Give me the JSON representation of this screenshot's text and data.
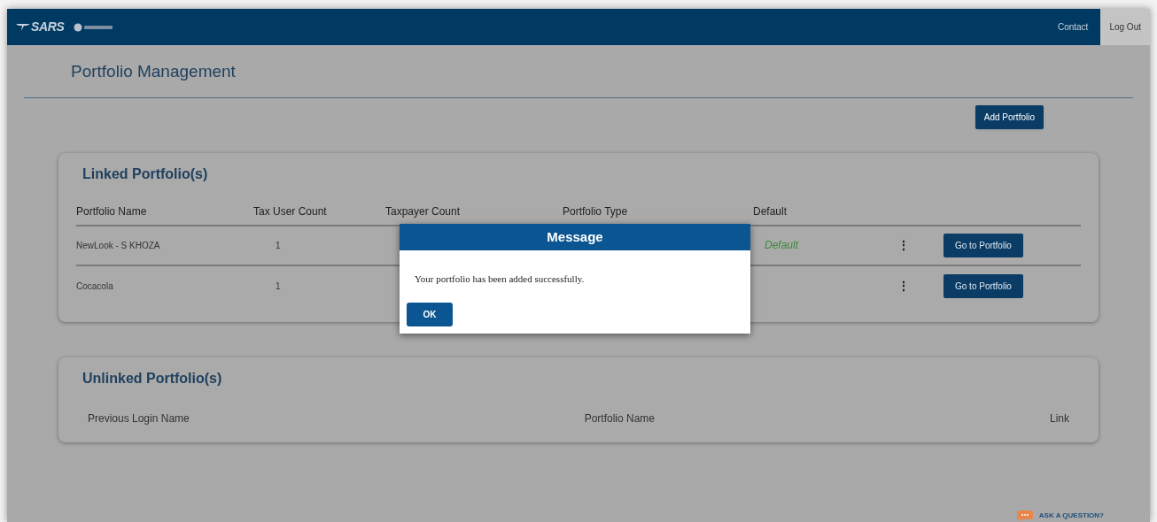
{
  "header": {
    "brand": "SARS",
    "nav": [
      {
        "label": "Contact",
        "selected": false
      },
      {
        "label": "Log Out",
        "selected": true
      }
    ]
  },
  "page_title": "Portfolio Management",
  "add_button": "Add Portfolio",
  "linked": {
    "title": "Linked Portfolio(s)",
    "columns": [
      "Portfolio Name",
      "Tax User Count",
      "Taxpayer Count",
      "Portfolio Type",
      "Default"
    ],
    "rows": [
      {
        "name": "NewLook - S KHOZA",
        "tax_user_count": "1",
        "default": "Default",
        "menu": "⋮",
        "button": "Go to Portfolio"
      },
      {
        "name": "Cocacola",
        "tax_user_count": "1",
        "menu": "⋮",
        "button": "Go to Portfolio"
      }
    ]
  },
  "unlinked": {
    "title": "Unlinked Portfolio(s)",
    "columns": [
      "Previous Login Name",
      "Portfolio Name",
      "Link"
    ]
  },
  "dialog": {
    "title": "Message",
    "text": "Your portfolio has been added successfully.",
    "button": "OK"
  },
  "help": "ASK A QUESTION?"
}
